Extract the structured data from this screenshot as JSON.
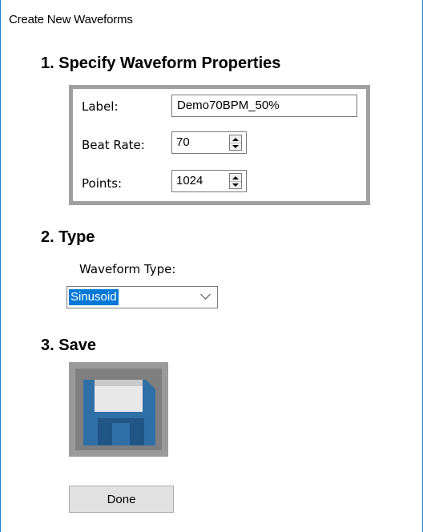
{
  "window": {
    "title": "Create New Waveforms"
  },
  "sections": {
    "properties": {
      "heading": "1. Specify Waveform Properties"
    },
    "type": {
      "heading": "2. Type"
    },
    "save": {
      "heading": "3. Save"
    }
  },
  "properties": {
    "label": {
      "caption": "Label:",
      "value": "Demo70BPM_50%"
    },
    "beat_rate": {
      "caption": "Beat Rate:",
      "value": "70"
    },
    "points": {
      "caption": "Points:",
      "value": "1024"
    }
  },
  "type": {
    "caption": "Waveform Type:",
    "selected": "Sinusoid"
  },
  "save": {
    "icon": "floppy-disk-icon"
  },
  "done_label": "Done",
  "colors": {
    "accent": "#0078d7",
    "window_border": "#1e7fd6",
    "frame_gray": "#a0a0a0",
    "floppy_blue": "#2f6fa5"
  }
}
